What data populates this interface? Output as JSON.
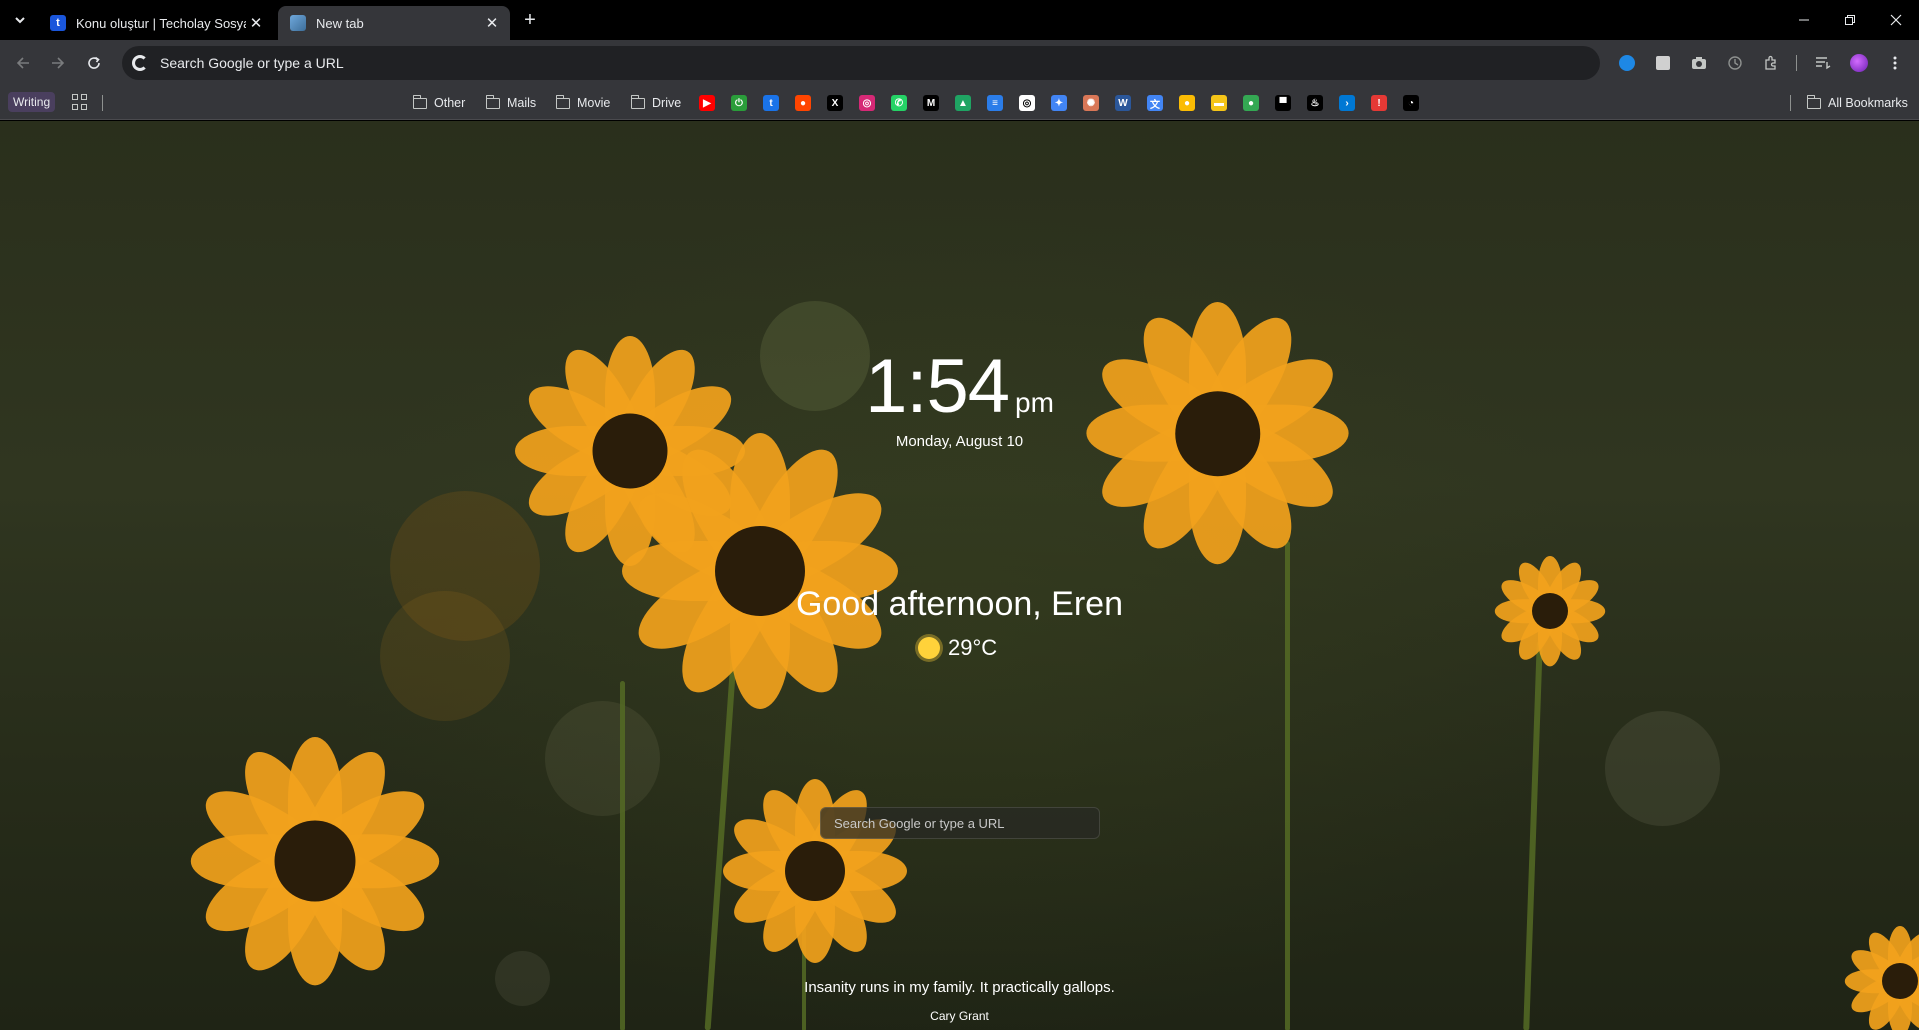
{
  "tabs": {
    "items": [
      {
        "title": "Konu oluştur | Techolay Sosyal",
        "favicon_letter": "t",
        "active": false
      },
      {
        "title": "New tab",
        "favicon_letter": "",
        "active": true
      }
    ]
  },
  "toolbar": {
    "omnibox_placeholder": "Search Google or type a URL"
  },
  "bookmarks": {
    "writing_label": "Writing",
    "folders": [
      "Other",
      "Mails",
      "Movie",
      "Drive"
    ],
    "all_bookmarks_label": "All Bookmarks",
    "icons": [
      {
        "name": "youtube-icon",
        "color": "#ff0000",
        "glyph": "▶"
      },
      {
        "name": "power-icon",
        "color": "#2a9d3a",
        "glyph": "⏻"
      },
      {
        "name": "techolay-icon",
        "color": "#1a73e8",
        "glyph": "t"
      },
      {
        "name": "reddit-icon",
        "color": "#ff4500",
        "glyph": "●"
      },
      {
        "name": "x-icon",
        "color": "#000000",
        "glyph": "X"
      },
      {
        "name": "instagram-icon",
        "color": "#d62976",
        "glyph": "◎"
      },
      {
        "name": "whatsapp-icon",
        "color": "#25d366",
        "glyph": "✆"
      },
      {
        "name": "medium-icon",
        "color": "#000000",
        "glyph": "M"
      },
      {
        "name": "google-drive-icon",
        "color": "#1fa463",
        "glyph": "▲"
      },
      {
        "name": "stack-icon",
        "color": "#2b7de9",
        "glyph": "≡"
      },
      {
        "name": "chatgpt-icon",
        "color": "#ffffff",
        "glyph": "◎"
      },
      {
        "name": "gemini-icon",
        "color": "#4285f4",
        "glyph": "✦"
      },
      {
        "name": "claude-icon",
        "color": "#d97757",
        "glyph": "✺"
      },
      {
        "name": "word-icon",
        "color": "#2b579a",
        "glyph": "W"
      },
      {
        "name": "translate-icon",
        "color": "#4285f4",
        "glyph": "文"
      },
      {
        "name": "keep-icon",
        "color": "#fbbc04",
        "glyph": "●"
      },
      {
        "name": "imdb-icon",
        "color": "#f5c518",
        "glyph": "▬"
      },
      {
        "name": "maps-icon",
        "color": "#34a853",
        "glyph": "●"
      },
      {
        "name": "printer-icon",
        "color": "#000000",
        "glyph": "▀"
      },
      {
        "name": "steam-icon",
        "color": "#000000",
        "glyph": "♨"
      },
      {
        "name": "terminal-icon",
        "color": "#0078d4",
        "glyph": "›"
      },
      {
        "name": "alert-icon",
        "color": "#e53935",
        "glyph": "!"
      },
      {
        "name": "github-icon",
        "color": "#000000",
        "glyph": "◔"
      }
    ]
  },
  "clock": {
    "time": "1:54",
    "ampm": "pm",
    "date": "Monday, August 10"
  },
  "greeting": "Good afternoon, Eren",
  "weather": {
    "temperature": "29°C",
    "icon": "sun-icon"
  },
  "page_search_placeholder": "Search Google or type a URL",
  "quote": {
    "text": "Insanity runs in my family. It practically gallops.",
    "author": "Cary Grant"
  },
  "colors": {
    "flower_petal": "#f2a21c",
    "flower_center": "#2a1d0a",
    "background": "#2a2f1c"
  }
}
